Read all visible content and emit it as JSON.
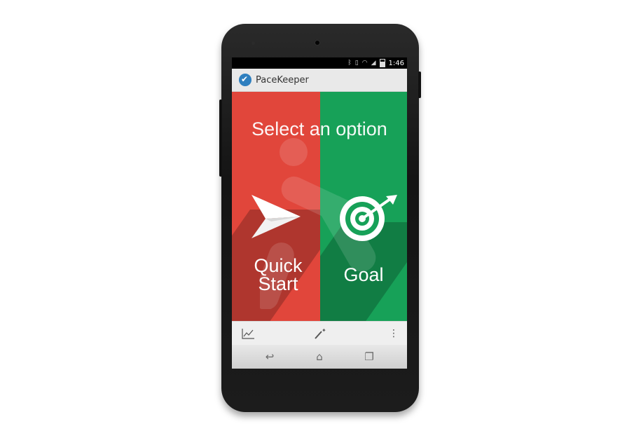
{
  "status_bar": {
    "time": "1:46"
  },
  "action_bar": {
    "app_title": "PaceKeeper"
  },
  "main": {
    "headline": "Select an option",
    "options": [
      {
        "label_line1": "Quick",
        "label_line2": "Start",
        "icon": "paper-plane-icon",
        "color": "#e1463b"
      },
      {
        "label": "Goal",
        "icon": "target-arrow-icon",
        "color": "#17a158"
      }
    ]
  },
  "bottom_bar": {
    "buttons": [
      "chart-icon",
      "magic-wand-icon",
      "overflow-menu-icon"
    ]
  },
  "nav_bar": {
    "buttons": [
      "back-icon",
      "home-icon",
      "recents-icon"
    ]
  }
}
